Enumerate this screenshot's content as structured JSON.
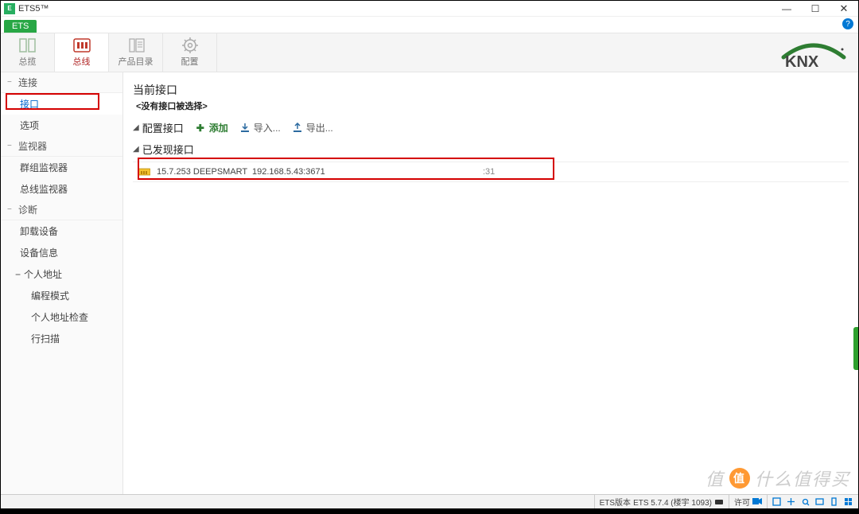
{
  "window": {
    "title": "ETS5™",
    "controls": {
      "min": "—",
      "max": "☐",
      "close": "✕"
    }
  },
  "menubar": {
    "ets_tab": "ETS",
    "help": "?"
  },
  "ribbon": {
    "tabs": [
      {
        "label": "总揽",
        "icon": "overview"
      },
      {
        "label": "总线",
        "icon": "bus"
      },
      {
        "label": "产品目录",
        "icon": "catalog"
      },
      {
        "label": "配置",
        "icon": "settings"
      }
    ],
    "logo": "KNX"
  },
  "sidebar": {
    "groups": [
      {
        "title": "连接",
        "items": [
          {
            "label": "接口",
            "selected": true
          },
          {
            "label": "选项"
          }
        ]
      },
      {
        "title": "监视器",
        "items": [
          {
            "label": "群组监视器"
          },
          {
            "label": "总线监视器"
          }
        ]
      },
      {
        "title": "诊断",
        "items": [
          {
            "label": "卸载设备"
          },
          {
            "label": "设备信息"
          },
          {
            "label": "个人地址",
            "expandable": true,
            "children": [
              {
                "label": "编程模式"
              },
              {
                "label": "个人地址检查"
              },
              {
                "label": "行扫描"
              }
            ]
          }
        ]
      }
    ]
  },
  "main": {
    "current_interface_title": "当前接口",
    "no_interface_selected": "<没有接口被选择>",
    "config_interface_label": "配置接口",
    "actions": {
      "add": "添加",
      "import": "导入...",
      "export": "导出..."
    },
    "discovered_title": "已发现接口",
    "interfaces": [
      {
        "addr_name": "15.7.253 DEEPSMART",
        "endpoint": "192.168.5.43:3671",
        "mac_tail": ":31"
      }
    ]
  },
  "statusbar": {
    "version_label": "ETS版本",
    "version_value": "ETS 5.7.4 (楼宇 1093)",
    "license": "许可"
  },
  "watermark": {
    "text": "值 , 什么值得买"
  }
}
